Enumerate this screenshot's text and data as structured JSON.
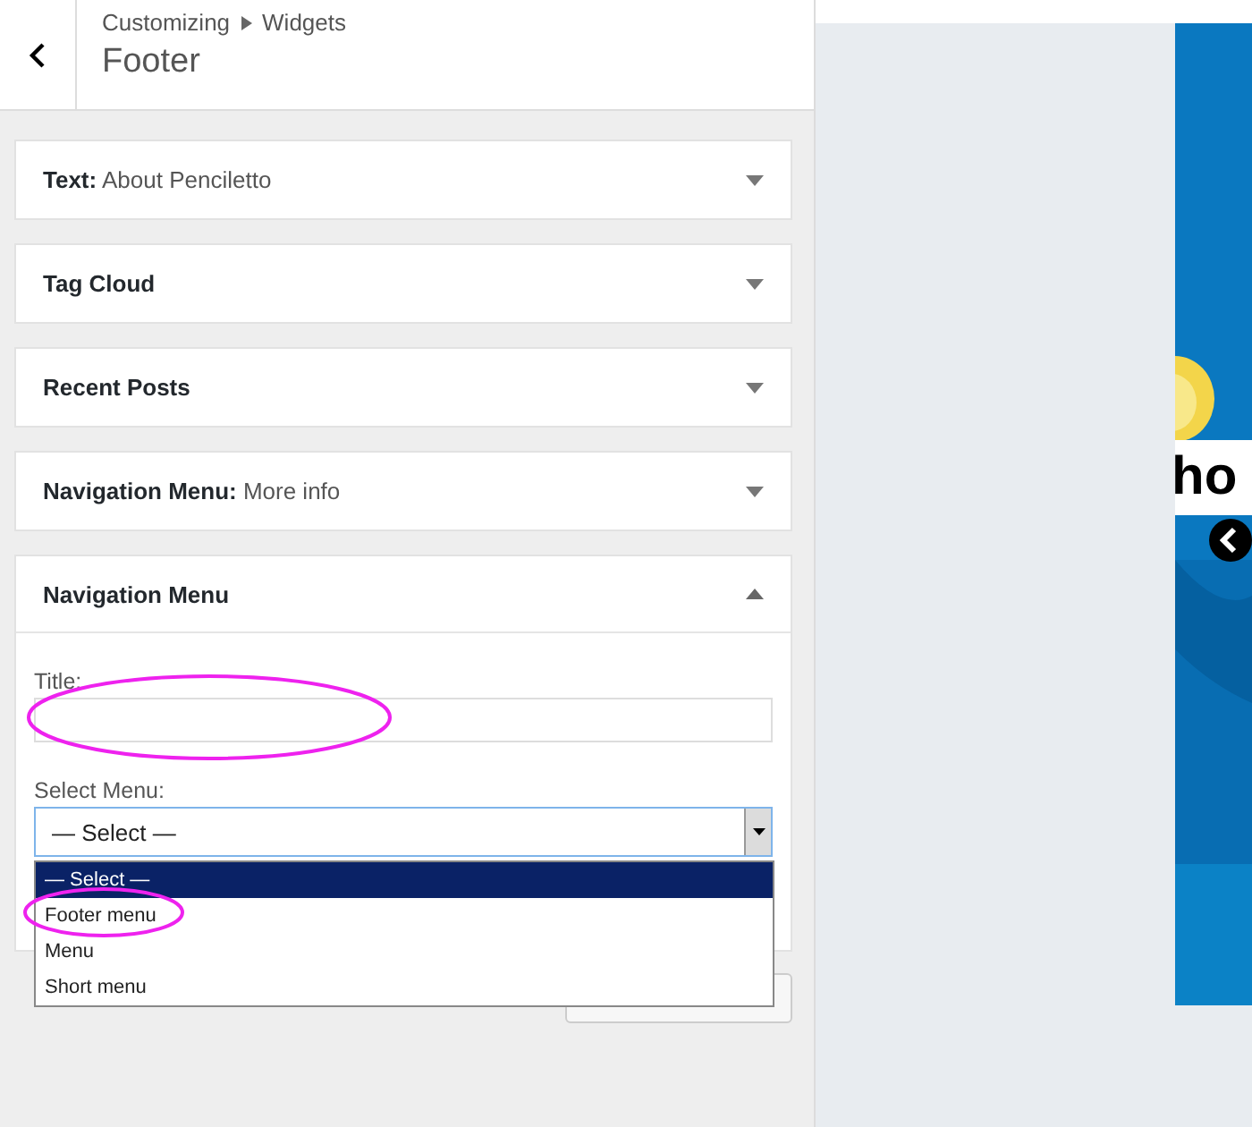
{
  "header": {
    "breadcrumb": [
      "Customizing",
      "Widgets"
    ],
    "title": "Footer"
  },
  "widgets": [
    {
      "title": "**Text:** About Penciletto",
      "expanded": false
    },
    {
      "title": "Tag Cloud",
      "expanded": false
    },
    {
      "title": "Recent Posts",
      "expanded": false
    },
    {
      "title": "**Navigation Menu:** More info",
      "expanded": false
    },
    {
      "title": "Navigation Menu",
      "expanded": true
    }
  ],
  "widget_form": {
    "title_label": "Title:",
    "menu_label": "Select Menu:",
    "menu_value": "— Select —",
    "options": [
      {
        "label": "— Select —",
        "selected": true
      },
      {
        "label": "Footer menu",
        "selected": false
      },
      {
        "label": "Menu",
        "selected": false
      },
      {
        "label": "Short menu",
        "selected": false
      }
    ]
  },
  "preview": {
    "heading": "ho"
  }
}
